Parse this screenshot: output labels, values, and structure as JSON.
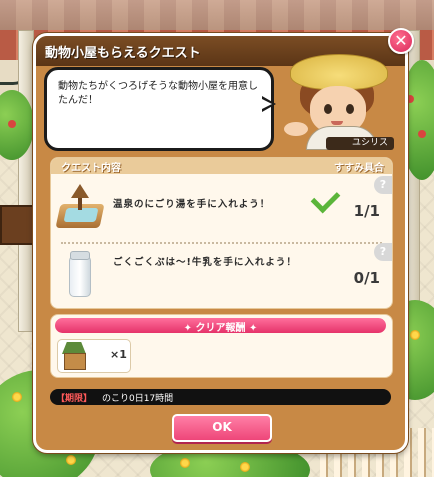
{
  "dialog": {
    "title": "動物小屋もらえるクエスト",
    "close_icon": "close-x-icon",
    "message": "動物たちがくつろげそうな動物小屋を用意したんだ！",
    "character_name": "ユシリス"
  },
  "quest": {
    "header_left": "クエスト内容",
    "header_right": "すすみ具合",
    "items": [
      {
        "text": "温泉のにごり湯を手に入れよう！",
        "progress": "1/1",
        "completed": true,
        "icon": "hot-spring-icon",
        "help": "?"
      },
      {
        "text": "ごくごくぷは～!牛乳を手に入れよう！",
        "progress": "0/1",
        "completed": false,
        "icon": "milk-bottle-icon",
        "help": "?"
      }
    ]
  },
  "reward": {
    "title": "✦ クリア報酬 ✦",
    "item_icon": "animal-house-icon",
    "quantity": "×1"
  },
  "deadline": {
    "tag": "【期限】",
    "text": "のこり0日17時間"
  },
  "ok_label": "OK",
  "colors": {
    "panel": "#c88945",
    "title_bar": "#5b3516",
    "accent_pink": "#ee4679",
    "check_green": "#5bb53a"
  }
}
